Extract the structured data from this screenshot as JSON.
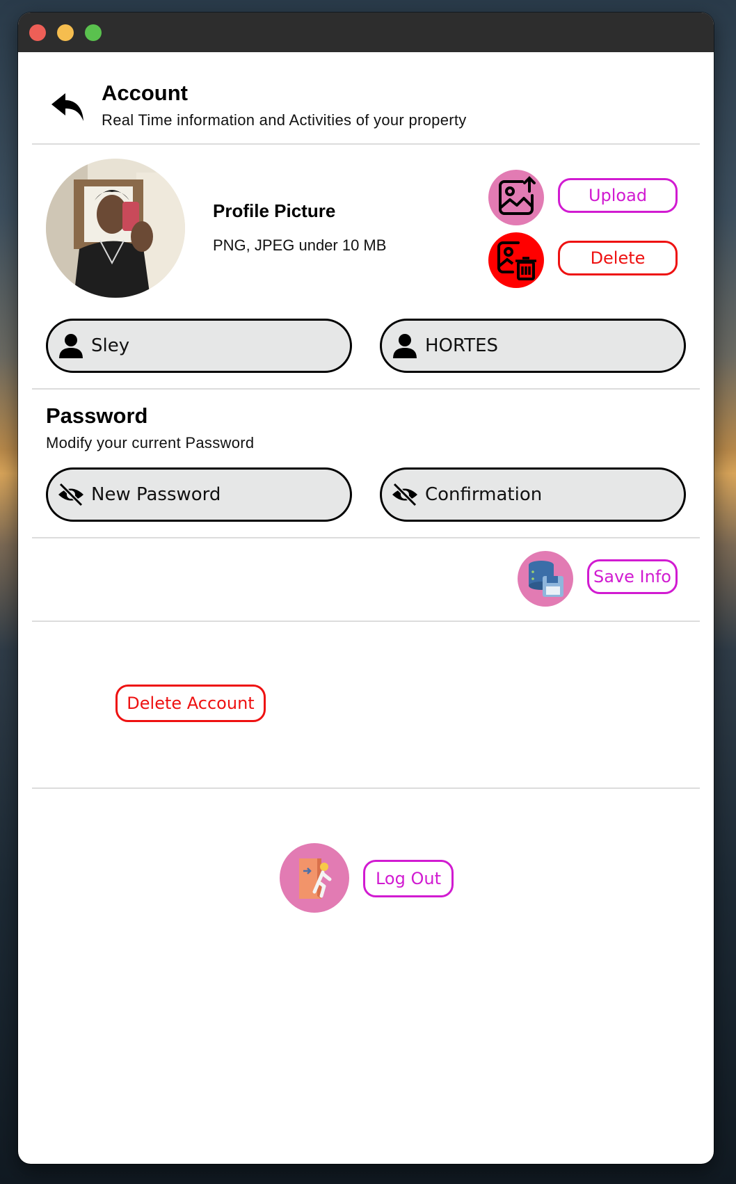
{
  "window": {
    "controls": [
      "close",
      "minimize",
      "maximize"
    ]
  },
  "header": {
    "back_icon": "back-arrow-icon",
    "title": "Account",
    "subtitle": "Real Time information and Activities of your property"
  },
  "profile": {
    "title": "Profile Picture",
    "hint": "PNG, JPEG under 10 MB",
    "upload_label": "Upload",
    "delete_label": "Delete",
    "upload_icon": "image-upload-icon",
    "delete_icon": "image-delete-icon"
  },
  "name_fields": {
    "first_name": "Sley",
    "last_name": "HORTES",
    "icon": "user-icon"
  },
  "password": {
    "title": "Password",
    "subtitle": "Modify your current Password",
    "new_placeholder": "New Password",
    "confirm_placeholder": "Confirmation",
    "icon": "eye-slash-icon"
  },
  "actions": {
    "save_label": "Save Info",
    "save_icon": "database-save-icon",
    "delete_account_label": "Delete Account",
    "logout_label": "Log Out",
    "logout_icon": "exit-door-icon"
  },
  "colors": {
    "accent_magenta": "#d11bd1",
    "danger_red": "#ee1111",
    "icon_pink": "#e27bb3",
    "field_bg": "#e6e7e7"
  }
}
